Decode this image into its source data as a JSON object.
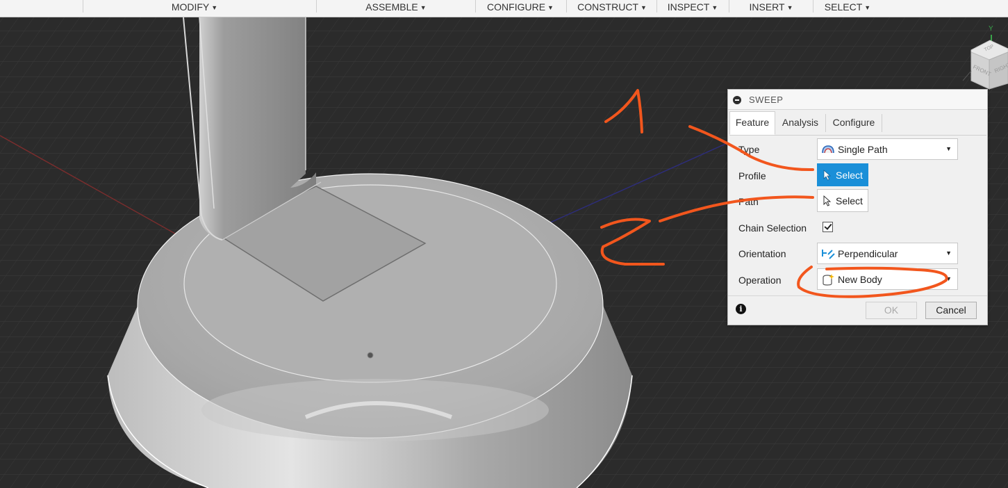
{
  "toolbar": {
    "menus": [
      {
        "label": "MODIFY"
      },
      {
        "label": "ASSEMBLE"
      },
      {
        "label": "CONFIGURE"
      },
      {
        "label": "CONSTRUCT"
      },
      {
        "label": "INSPECT"
      },
      {
        "label": "INSERT"
      },
      {
        "label": "SELECT"
      }
    ]
  },
  "viewcube": {
    "axis_label": "Y",
    "faces": {
      "top": "TOP",
      "front": "FRONT",
      "right": "RIGHT"
    }
  },
  "dialog": {
    "title": "SWEEP",
    "tabs": [
      {
        "label": "Feature",
        "active": true
      },
      {
        "label": "Analysis",
        "active": false
      },
      {
        "label": "Configure",
        "active": false
      }
    ],
    "type": {
      "label": "Type",
      "value": "Single Path",
      "icon": "single-path-icon"
    },
    "profile": {
      "label": "Profile",
      "button": "Select",
      "active": true
    },
    "path": {
      "label": "Path",
      "button": "Select",
      "active": false
    },
    "chain_selection": {
      "label": "Chain Selection",
      "checked": true
    },
    "orientation": {
      "label": "Orientation",
      "value": "Perpendicular",
      "icon": "perpendicular-icon"
    },
    "operation": {
      "label": "Operation",
      "value": "New Body",
      "icon": "new-body-icon"
    },
    "ok": "OK",
    "cancel": "Cancel"
  },
  "colors": {
    "accent": "#1a8fd8",
    "annotation": "#f2561d",
    "viewport_bg": "#2b2b2b"
  }
}
